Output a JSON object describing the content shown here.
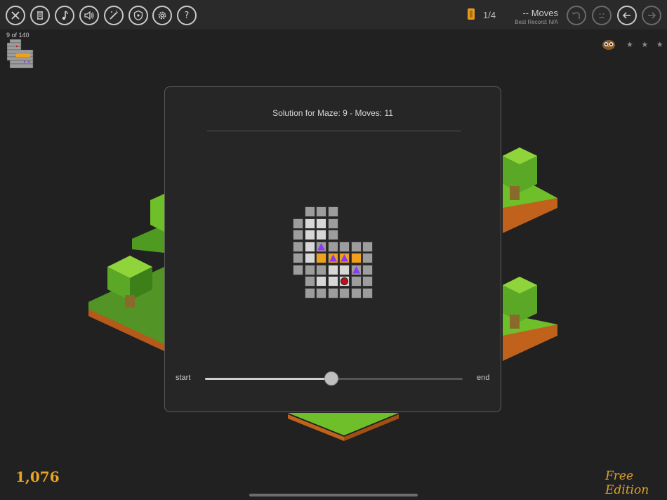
{
  "toolbar": {
    "icons": [
      "close-icon",
      "scroll-icon",
      "music-icon",
      "sound-icon",
      "magic-wand-icon",
      "shield-icon",
      "gear-icon",
      "help-icon"
    ],
    "counter": "1/4",
    "moves": "-- Moves",
    "best_record": "Best Record: N/A",
    "right_icons": [
      "undo-icon",
      "sad-face-icon",
      "back-arrow-icon",
      "forward-arrow-icon"
    ]
  },
  "maze_count": "9 of 140",
  "score": "1,076",
  "edition": "Free Edition",
  "stars": "★ ★ ★",
  "dialog": {
    "title": "Solution for Maze: 9  -  Moves: 11",
    "slider": {
      "start_label": "start",
      "end_label": "end",
      "value": 0.49
    }
  },
  "colors": {
    "accent": "#e8a423",
    "path": "#f0a01c",
    "triangle": "#8c3cf0",
    "ball": "#c0101a",
    "light_cell": "#d7d7d7",
    "dark_cell": "#9d9d9d"
  }
}
